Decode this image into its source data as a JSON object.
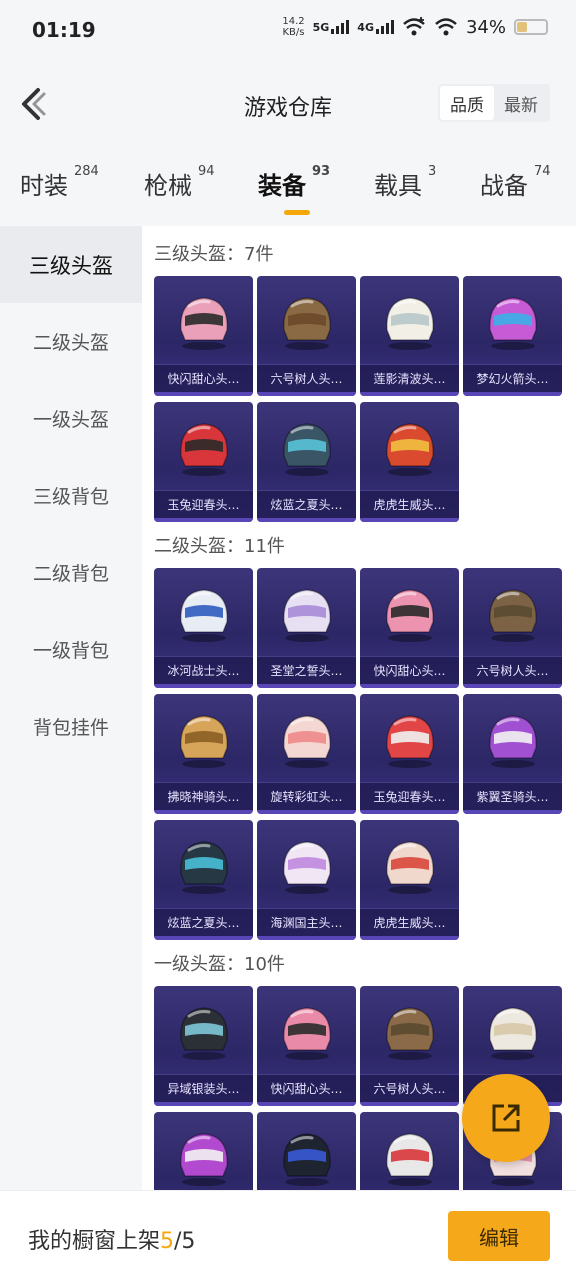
{
  "status_bar": {
    "time": "01:19",
    "net_speed_value": "14.2",
    "net_speed_unit": "KB/s",
    "signal_1": "5G",
    "signal_2": "4G",
    "battery": "34%",
    "battery_level": 0.34
  },
  "header": {
    "title": "游戏仓库",
    "sort_quality": "品质",
    "sort_latest": "最新"
  },
  "tabs": [
    {
      "label": "时装",
      "count": "284"
    },
    {
      "label": "枪械",
      "count": "94"
    },
    {
      "label": "装备",
      "count": "93"
    },
    {
      "label": "载具",
      "count": "3"
    },
    {
      "label": "战备",
      "count": "74"
    }
  ],
  "sidebar": [
    {
      "label": "三级头盔"
    },
    {
      "label": "二级头盔"
    },
    {
      "label": "一级头盔"
    },
    {
      "label": "三级背包"
    },
    {
      "label": "二级背包"
    },
    {
      "label": "一级背包"
    },
    {
      "label": "背包挂件"
    }
  ],
  "sections": [
    {
      "title": "三级头盔：7件",
      "items": [
        {
          "name": "快闪甜心头…",
          "color": "#e9a0b8",
          "visor": "#2a2a2a"
        },
        {
          "name": "六号树人头…",
          "color": "#8a6a44",
          "visor": "#6b4a2a"
        },
        {
          "name": "莲影清波头…",
          "color": "#f2efe6",
          "visor": "#b8c7c9"
        },
        {
          "name": "梦幻火箭头…",
          "color": "#c75bd6",
          "visor": "#3ab0e8"
        },
        {
          "name": "玉兔迎春头…",
          "color": "#d8363b",
          "visor": "#2a2a2a"
        },
        {
          "name": "炫蓝之夏头…",
          "color": "#3a5566",
          "visor": "#5ac3d8"
        },
        {
          "name": "虎虎生威头…",
          "color": "#d94a2e",
          "visor": "#f0c040"
        }
      ]
    },
    {
      "title": "二级头盔：11件",
      "items": [
        {
          "name": "冰河战士头…",
          "color": "#e8edf5",
          "visor": "#2e5bbf"
        },
        {
          "name": "圣堂之誓头…",
          "color": "#e6e0f2",
          "visor": "#a78bd8"
        },
        {
          "name": "快闪甜心头…",
          "color": "#ec93b0",
          "visor": "#2a2a2a"
        },
        {
          "name": "六号树人头…",
          "color": "#7c6346",
          "visor": "#5a4a30"
        },
        {
          "name": "拂晓神骑头…",
          "color": "#d7a55a",
          "visor": "#8a5f22"
        },
        {
          "name": "旋转彩虹头…",
          "color": "#f4d7d2",
          "visor": "#f08a8a"
        },
        {
          "name": "玉兔迎春头…",
          "color": "#e24545",
          "visor": "#f2f2f2"
        },
        {
          "name": "紫翼圣骑头…",
          "color": "#a050d0",
          "visor": "#f2f2f2"
        },
        {
          "name": "炫蓝之夏头…",
          "color": "#263844",
          "visor": "#4ac0d8"
        },
        {
          "name": "海渊国主头…",
          "color": "#f0e6f4",
          "visor": "#c088e0"
        },
        {
          "name": "虎虎生威头…",
          "color": "#f0d8cc",
          "visor": "#d8483a"
        }
      ]
    },
    {
      "title": "一级头盔：10件",
      "items": [
        {
          "name": "异域银装头…",
          "color": "#2a3036",
          "visor": "#7ec6d8"
        },
        {
          "name": "快闪甜心头…",
          "color": "#e98aa8",
          "visor": "#2a2a2a"
        },
        {
          "name": "六号树人头…",
          "color": "#8a6a48",
          "visor": "#5a4a30"
        },
        {
          "name": "",
          "color": "#ede8e0",
          "visor": "#d8c8a8"
        },
        {
          "name": "",
          "color": "#b24ad0",
          "visor": "#f2f2f2"
        },
        {
          "name": "",
          "color": "#1e2430",
          "visor": "#3a5ad8"
        },
        {
          "name": "",
          "color": "#e8e8e8",
          "visor": "#d8363b"
        },
        {
          "name": "",
          "color": "#f2e0e0",
          "visor": "#e88aa0"
        }
      ]
    }
  ],
  "bottom": {
    "label_prefix": "我的橱窗上架",
    "count_current": "5",
    "count_sep": "/5",
    "edit_label": "编辑"
  },
  "icons": {
    "back": "chevron-left-icon",
    "share": "share-out-icon"
  },
  "colors": {
    "accent": "#f6a81b",
    "card_bg": "#2c2766"
  }
}
